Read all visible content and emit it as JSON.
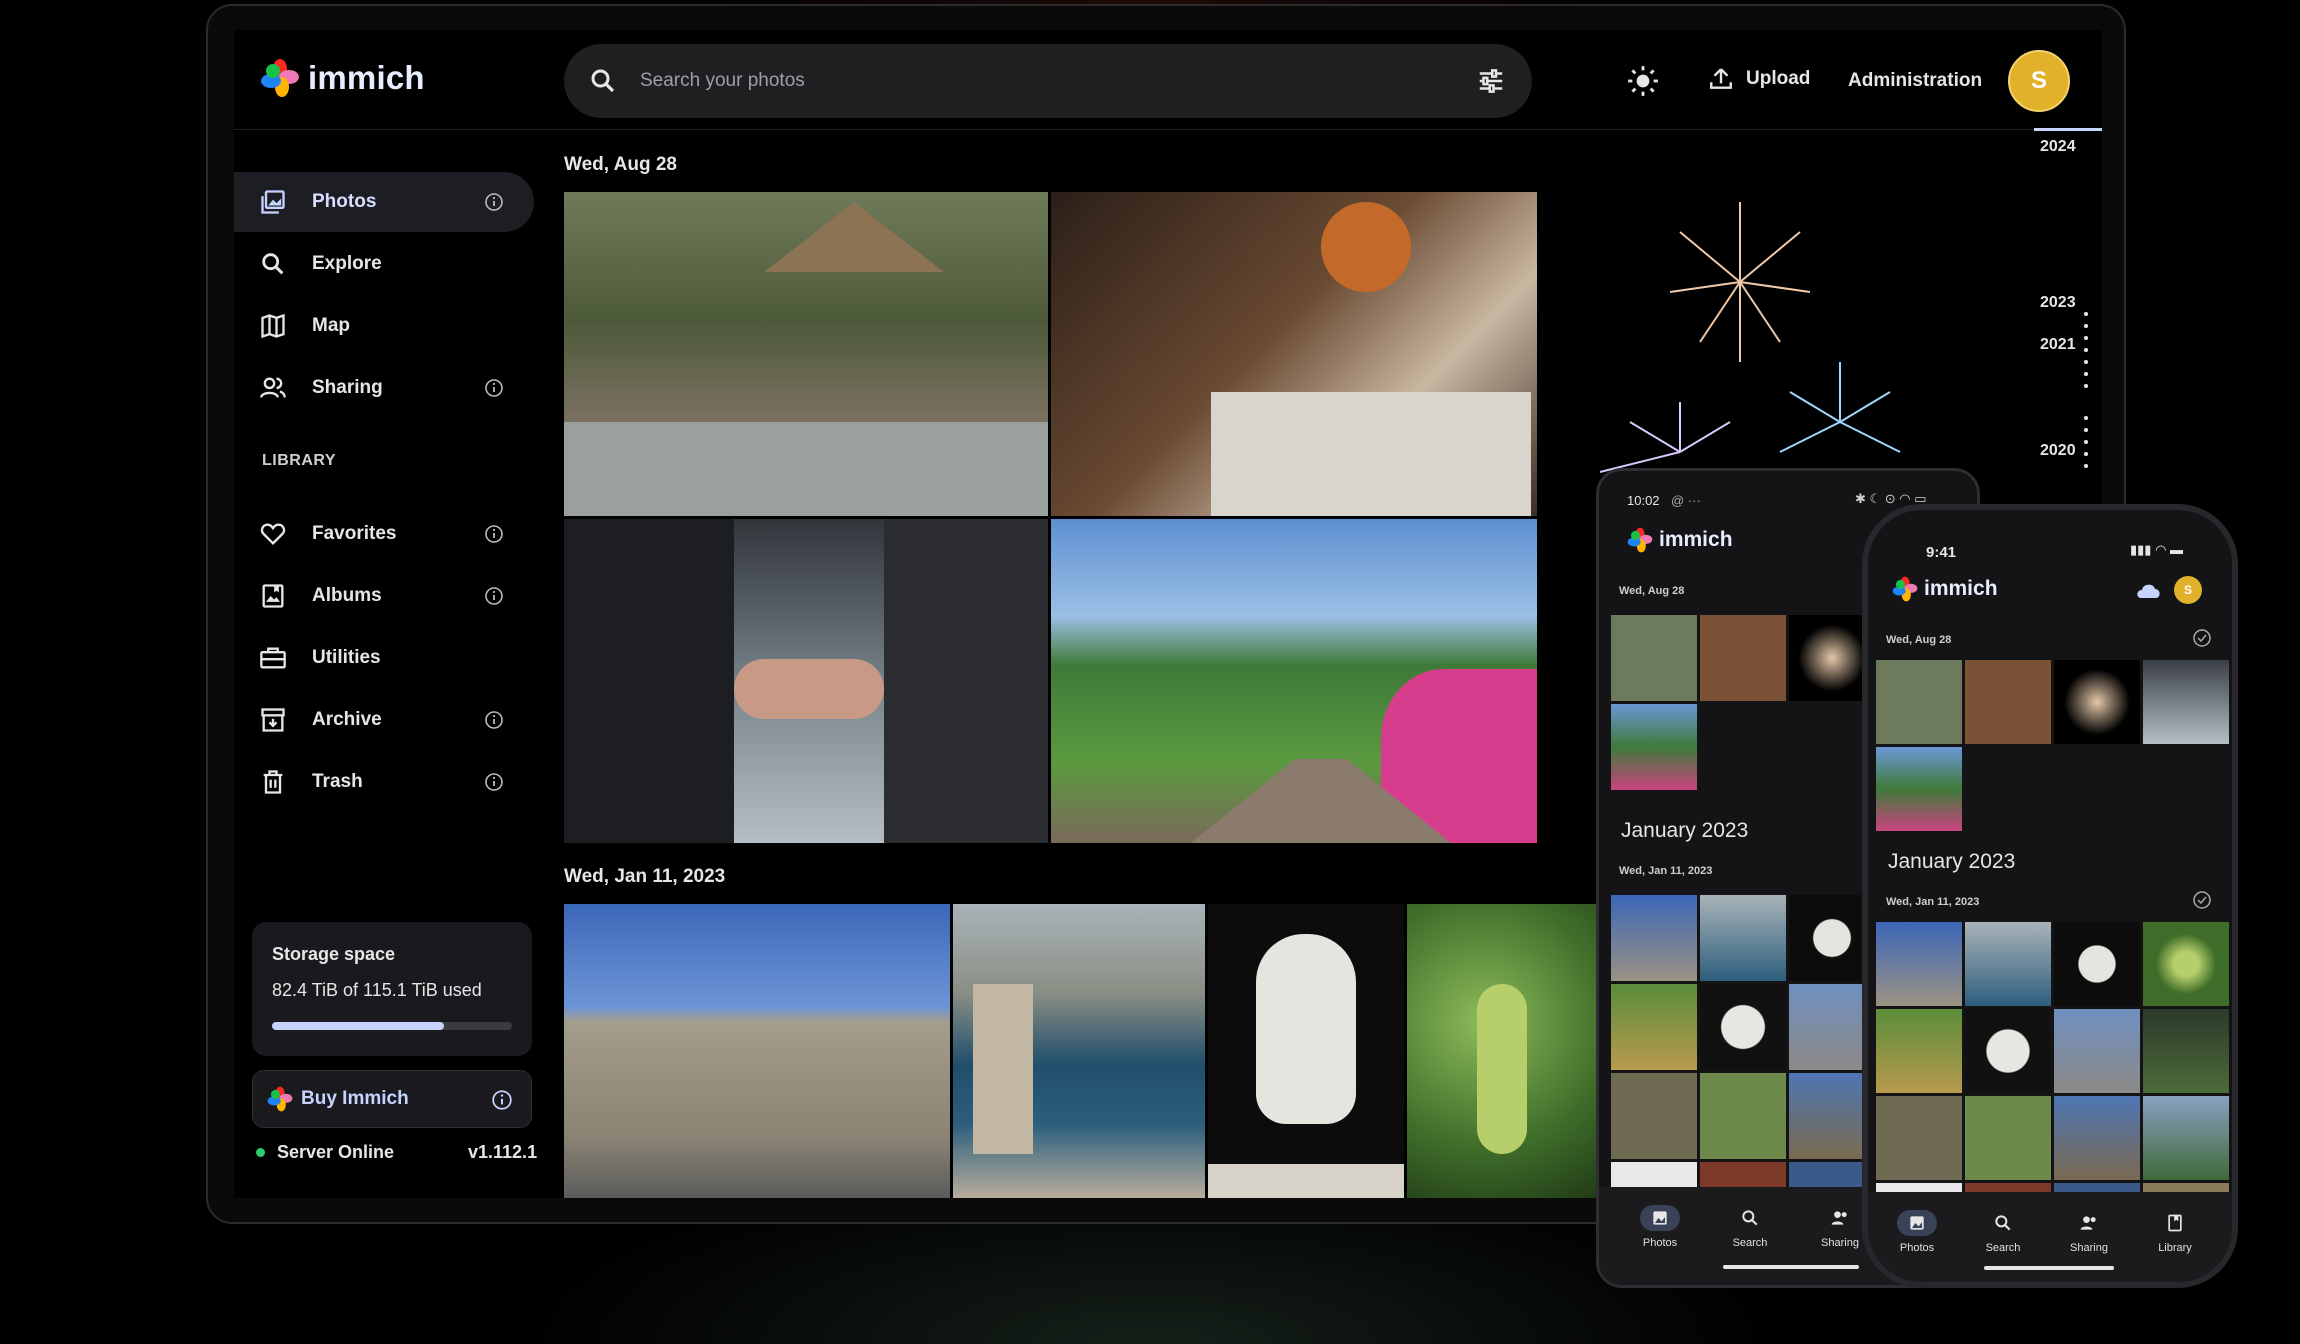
{
  "app": {
    "name": "immich"
  },
  "colors": {
    "accent": "#c6d3ff",
    "avatar": "#e1b12c",
    "online": "#2ecc71",
    "background": "#000000"
  },
  "header": {
    "search_placeholder": "Search your photos",
    "upload_label": "Upload",
    "admin_label": "Administration",
    "avatar_initial": "S",
    "icons": [
      "search-icon",
      "tune-icon",
      "theme-toggle-icon",
      "upload-icon"
    ]
  },
  "sidebar": {
    "items": [
      {
        "label": "Photos",
        "icon": "photos-icon",
        "info": true,
        "active": true
      },
      {
        "label": "Explore",
        "icon": "search-icon",
        "info": false
      },
      {
        "label": "Map",
        "icon": "map-icon",
        "info": false
      },
      {
        "label": "Sharing",
        "icon": "people-icon",
        "info": true
      }
    ],
    "library_heading": "LIBRARY",
    "library_items": [
      {
        "label": "Favorites",
        "icon": "heart-icon",
        "info": true
      },
      {
        "label": "Albums",
        "icon": "album-icon",
        "info": true
      },
      {
        "label": "Utilities",
        "icon": "toolbox-icon",
        "info": false
      },
      {
        "label": "Archive",
        "icon": "archive-icon",
        "info": true
      },
      {
        "label": "Trash",
        "icon": "trash-icon",
        "info": true
      }
    ],
    "storage": {
      "title": "Storage space",
      "usage": "82.4 TiB of 115.1 TiB used",
      "used_fraction": 0.716
    },
    "buy_label": "Buy Immich",
    "server_status": "Server Online",
    "version": "v1.112.1"
  },
  "timeline": {
    "groups": [
      {
        "date": "Wed, Aug 28",
        "photos": [
          "zoo-monkeys",
          "dinner-table",
          "fireworks",
          "holding-hands",
          "garden-path"
        ]
      },
      {
        "date": "Wed, Jan 11, 2023",
        "photos": [
          "fortress-wall",
          "coastal-tower",
          "marble-bust",
          "sea-grapes"
        ]
      }
    ],
    "scrubber_years": [
      "2024",
      "2023",
      "2021",
      "2020"
    ]
  },
  "phone_android": {
    "status_time": "10:02",
    "status_icons": "@ ···",
    "app_name": "immich",
    "group1_date": "Wed, Aug 28",
    "month_heading": "January 2023",
    "group2_date": "Wed, Jan 11, 2023",
    "nav": [
      "Photos",
      "Search",
      "Sharing"
    ]
  },
  "phone_ios": {
    "status_time": "9:41",
    "app_name": "immich",
    "group1_date": "Wed, Aug 28",
    "month_heading": "January 2023",
    "group2_date": "Wed, Jan 11, 2023",
    "nav": [
      "Photos",
      "Search",
      "Sharing",
      "Library"
    ]
  }
}
